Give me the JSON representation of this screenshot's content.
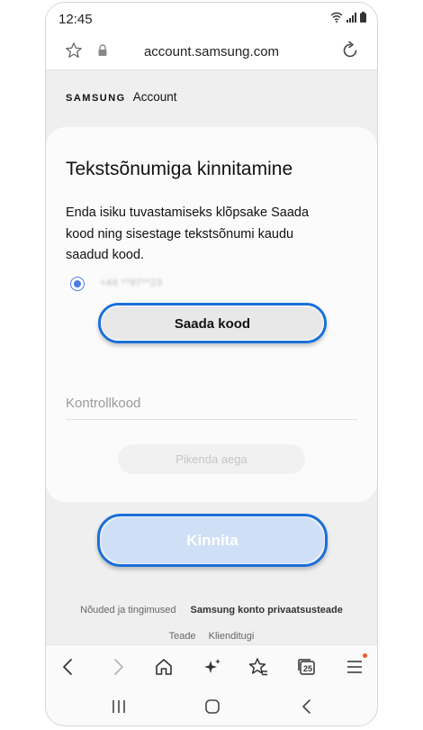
{
  "status_bar": {
    "time": "12:45"
  },
  "browser": {
    "url": "account.samsung.com"
  },
  "brand": {
    "samsung": "SAMSUNG",
    "account": "Account"
  },
  "card": {
    "title": "Tekstsõnumiga kinnitamine",
    "description": "Enda isiku tuvastamiseks klõpsake Saada kood ning sisestage tekstsõnumi kaudu saadud kood.",
    "phone_option": {
      "selected": true,
      "masked_number": "+44 **97**23"
    },
    "send_code_label": "Saada kood",
    "code_placeholder": "Kontrollkood",
    "extend_label": "Pikenda aega"
  },
  "confirm_label": "Kinnita",
  "footer": {
    "terms": "Nõuded ja tingimused",
    "privacy": "Samsung konto privaatsusteade",
    "notice": "Teade",
    "support": "Klienditugi"
  },
  "toolbar": {
    "tabs_count": "25",
    "menu_has_badge": true
  },
  "colors": {
    "accent": "#1a6fd8",
    "radio": "#4a7fe0",
    "confirm_disabled": "#cfdff6",
    "badge": "#f05a24"
  }
}
